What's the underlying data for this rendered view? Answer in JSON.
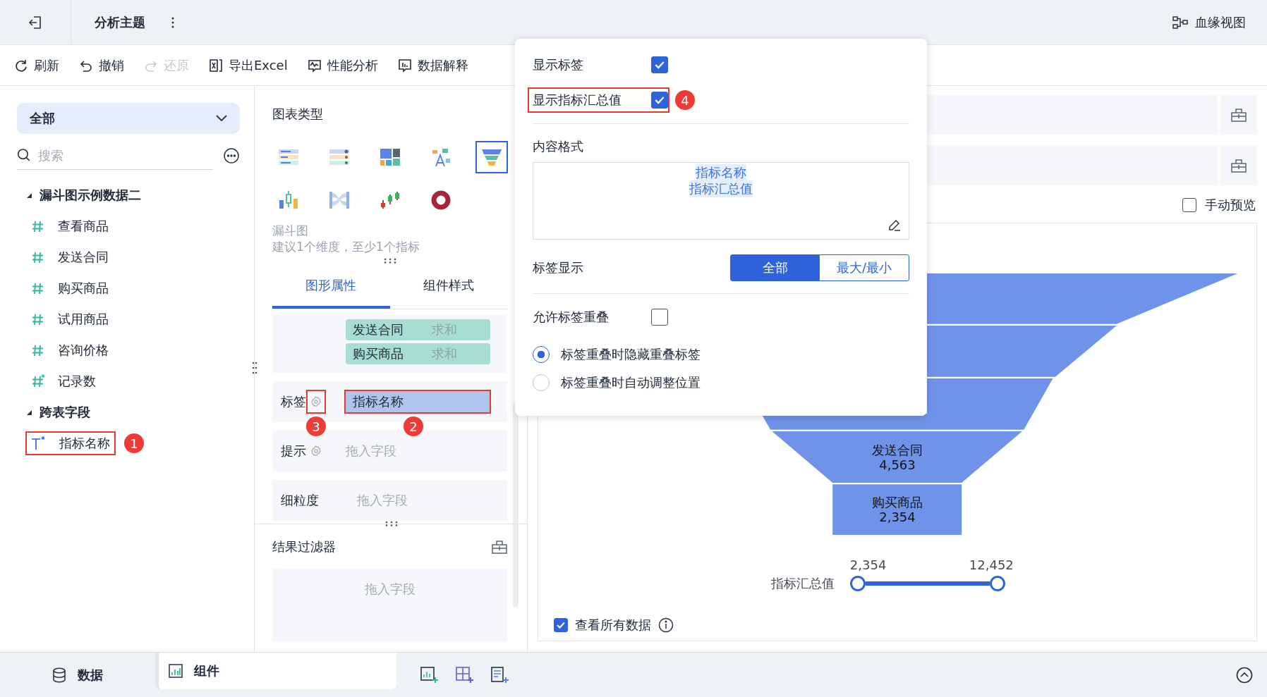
{
  "topbar": {
    "title": "分析主题",
    "lineage": "血缘视图"
  },
  "toolbar": [
    {
      "label": "刷新",
      "kind": "refresh",
      "disabled": false
    },
    {
      "label": "撤销",
      "kind": "undo",
      "disabled": false
    },
    {
      "label": "还原",
      "kind": "redo",
      "disabled": true
    },
    {
      "label": "导出Excel",
      "kind": "excel",
      "disabled": false
    },
    {
      "label": "性能分析",
      "kind": "perf",
      "disabled": false
    },
    {
      "label": "数据解释",
      "kind": "explain",
      "disabled": false
    }
  ],
  "sidebar": {
    "scope": "全部",
    "search_placeholder": "搜索",
    "groups": [
      {
        "name": "漏斗图示例数据二",
        "expanded": true,
        "children": [
          {
            "label": "查看商品",
            "kind": "measure"
          },
          {
            "label": "发送合同",
            "kind": "measure"
          },
          {
            "label": "购买商品",
            "kind": "measure"
          },
          {
            "label": "试用商品",
            "kind": "measure"
          },
          {
            "label": "咨询价格",
            "kind": "measure"
          },
          {
            "label": "记录数",
            "kind": "count"
          }
        ]
      },
      {
        "name": "跨表字段",
        "expanded": true,
        "children": [
          {
            "label": "指标名称",
            "kind": "text",
            "callout": "1"
          }
        ]
      }
    ]
  },
  "chart_types": {
    "title": "图表类型",
    "types": [
      {
        "kind": "rank",
        "selected": false
      },
      {
        "kind": "list",
        "selected": false
      },
      {
        "kind": "treemap",
        "selected": false
      },
      {
        "kind": "wordcloud",
        "selected": false
      },
      {
        "kind": "funnel",
        "selected": true
      },
      {
        "kind": "boxplot",
        "selected": false
      },
      {
        "kind": "sankey",
        "selected": false
      },
      {
        "kind": "candle",
        "selected": false
      },
      {
        "kind": "ring",
        "selected": false
      }
    ],
    "name": "漏斗图",
    "hint": "建议1个维度，至少1个指标"
  },
  "property_tabs": [
    {
      "label": "图形属性",
      "selected": true
    },
    {
      "label": "组件样式",
      "selected": false
    }
  ],
  "measures": [
    {
      "name": "发送合同",
      "agg": "求和"
    },
    {
      "name": "购买商品",
      "agg": "求和"
    }
  ],
  "slots": [
    {
      "label": "标签",
      "gear": true,
      "gear_callout": "3",
      "field": "指标名称",
      "field_callout": "2"
    },
    {
      "label": "提示",
      "gear": true,
      "placeholder": "拖入字段"
    },
    {
      "label": "细粒度",
      "gear": false,
      "placeholder": "拖入字段"
    }
  ],
  "result_filter": {
    "title": "结果过滤器",
    "placeholder": "拖入字段"
  },
  "canvas": {
    "manual_preview": {
      "label": "手动预览",
      "checked": false
    },
    "funnel_labels": [
      {
        "name": "发送合同",
        "value": "4,563"
      },
      {
        "name": "购买商品",
        "value": "2,354"
      }
    ],
    "slider": {
      "label": "指标汇总值",
      "min_label": "2,354",
      "max_label": "12,452",
      "thumbs": [
        {
          "level": 0
        },
        {
          "level": 1
        }
      ]
    },
    "view_all": {
      "label": "查看所有数据",
      "checked": true
    }
  },
  "popup": {
    "show_label": {
      "label": "显示标签",
      "checked": true
    },
    "show_total": {
      "label": "显示指标汇总值",
      "checked": true,
      "callout": "4"
    },
    "format_title": "内容格式",
    "format_lines": [
      "指标名称",
      "指标汇总值"
    ],
    "label_display": {
      "label": "标签显示",
      "options": [
        {
          "label": "全部",
          "selected": true
        },
        {
          "label": "最大/最小",
          "selected": false
        }
      ]
    },
    "allow_overlap": {
      "label": "允许标签重叠",
      "checked": false
    },
    "overlap_modes": [
      {
        "label": "标签重叠时隐藏重叠标签",
        "selected": true
      },
      {
        "label": "标签重叠时自动调整位置",
        "selected": false
      }
    ]
  },
  "bottom": {
    "tabs": [
      {
        "label": "数据",
        "kind": "db",
        "selected": false
      },
      {
        "label": "组件",
        "kind": "chart",
        "selected": true
      }
    ]
  }
}
